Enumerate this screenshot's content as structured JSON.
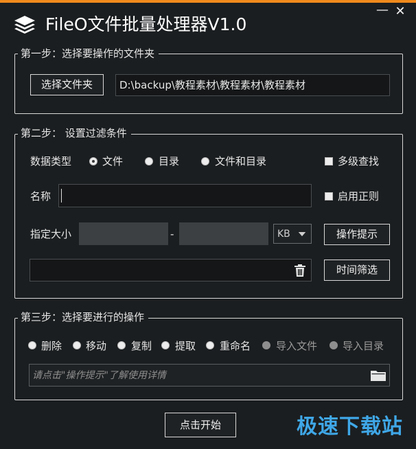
{
  "app": {
    "title": "FileO文件批量处理器V1.0",
    "accent_color": "#f08a1c",
    "minimize_glyph": "—",
    "close_glyph": "✕"
  },
  "step1": {
    "legend": "第一步：选择要操作的文件夹",
    "choose_button": "选择文件夹",
    "path_value": "D:\\backup\\教程素材\\教程素材\\教程素材"
  },
  "step2": {
    "legend": "第二步： 设置过滤条件",
    "data_type_label": "数据类型",
    "data_type_options": [
      "文件",
      "目录",
      "文件和目录"
    ],
    "data_type_selected": "文件",
    "multi_level_label": "多级查找",
    "name_label": "名称",
    "name_value": "",
    "regex_label": "启用正则",
    "size_label": "指定大小",
    "size_separator": "-",
    "size_min": "",
    "size_max": "",
    "size_unit": "KB",
    "hint_button": "操作提示",
    "time_filter_button": "时间筛选",
    "list_value": ""
  },
  "step3": {
    "legend": "第三步：选择要进行的操作",
    "operations": [
      "删除",
      "移动",
      "复制",
      "提取",
      "重命名",
      "导入文件",
      "导入目录"
    ],
    "input_placeholder": "请点击\"操作提示\"了解使用详情"
  },
  "start_button": "点击开始",
  "watermark": "极速下载站"
}
